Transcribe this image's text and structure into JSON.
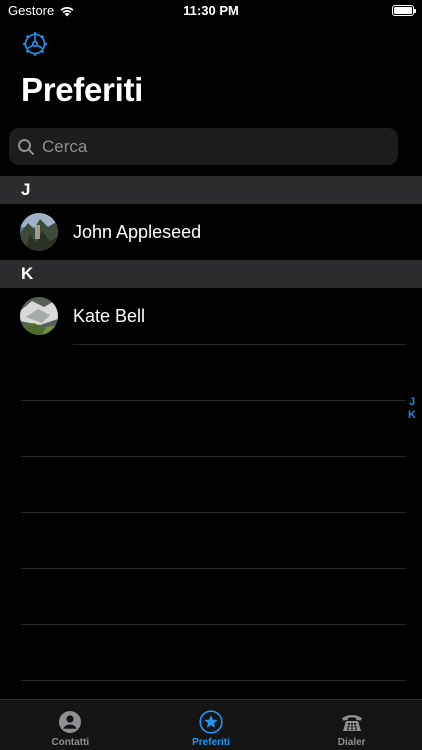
{
  "status_bar": {
    "carrier": "Gestore",
    "time": "11:30 PM"
  },
  "header": {
    "settings_icon": "gear-icon",
    "title": "Preferiti"
  },
  "search": {
    "placeholder": "Cerca",
    "value": ""
  },
  "sections": [
    {
      "letter": "J",
      "contacts": [
        {
          "name": "John Appleseed",
          "avatar": "photo-avatar"
        }
      ]
    },
    {
      "letter": "K",
      "contacts": [
        {
          "name": "Kate Bell",
          "avatar": "photo-avatar"
        }
      ]
    }
  ],
  "index": [
    "J",
    "K"
  ],
  "tabs": [
    {
      "label": "Contatti",
      "icon": "person-icon",
      "active": false
    },
    {
      "label": "Preferiti",
      "icon": "star-icon",
      "active": true
    },
    {
      "label": "Dialer",
      "icon": "phone-icon",
      "active": false
    }
  ],
  "colors": {
    "accent": "#2196f3",
    "background": "#000000",
    "section_header": "#2c2c2e",
    "search_bg": "#1c1c1e"
  }
}
